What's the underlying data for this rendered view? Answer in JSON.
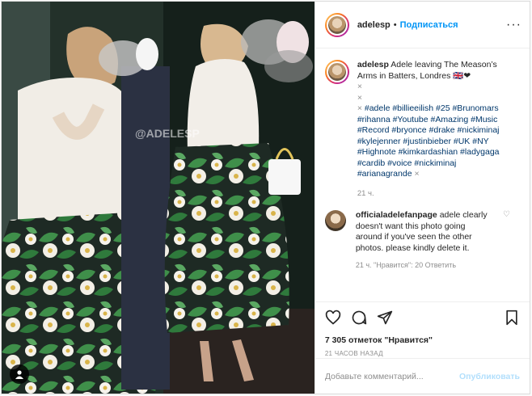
{
  "post": {
    "username": "adelesp",
    "follow_label": "Подписаться",
    "more_icon": "more-horizontal-icon",
    "watermark": "@ADELESP"
  },
  "caption": {
    "username": "adelesp",
    "text": "Adele leaving The Meason’s Arms in Batters, Londres",
    "emoji": "🇬🇧❤",
    "x1": "×",
    "x2": "×",
    "x3": "×",
    "hashtags": "#adele #billieeilish #25 #Brunomars #rihanna #Youtube #Amazing #Music #Record #bryonce #drake #nickiminaj #kylejenner #justinbieber #UK #NY #Highnote #kimkardashian #ladygaga #cardib #voice #nickiminaj #arianagrande",
    "x_end": "×",
    "time": "21 ч."
  },
  "comment": {
    "username": "officialadelefanpage",
    "text": "adele clearly doesn't want this photo going around if you've seen the other photos. please kindly delete it.",
    "meta": "21 ч.   \"Нравится\": 20   Ответить"
  },
  "actions": {
    "like_icon": "heart-icon",
    "comment_icon": "comment-icon",
    "share_icon": "share-icon",
    "save_icon": "bookmark-icon"
  },
  "likes": "7 305 отметок \"Нравится\"",
  "ago": "21 ЧАСОВ НАЗАД",
  "add_comment": {
    "placeholder": "Добавьте комментарий...",
    "publish_label": "Опубликовать"
  },
  "colors": {
    "link": "#00376b",
    "accent": "#0095f6",
    "publish_disabled": "#b2dffc",
    "muted": "#8e8e8e"
  }
}
